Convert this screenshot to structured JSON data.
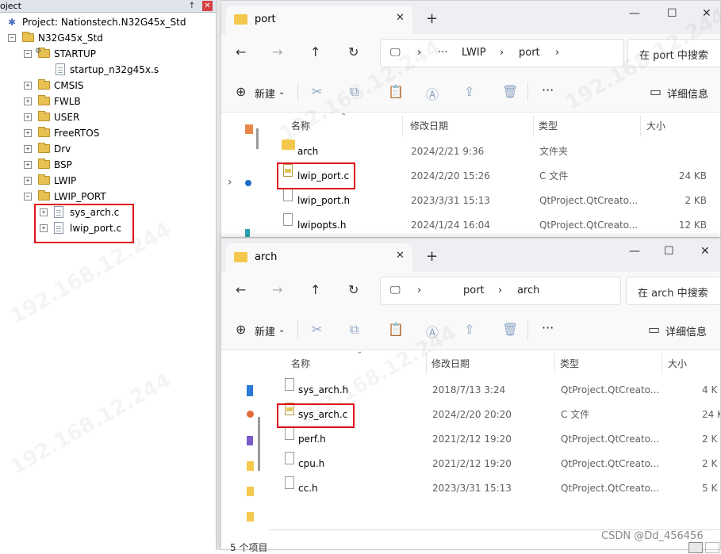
{
  "project": {
    "title": "oject",
    "pin_glyph": "↑",
    "close_glyph": "✕",
    "tree": [
      {
        "label": "Project: Nationstech.N32G45x_Std",
        "kind": "project"
      },
      {
        "label": "N32G45x_Std",
        "kind": "target"
      },
      {
        "label": "STARTUP",
        "kind": "group"
      },
      {
        "label": "startup_n32g45x.s",
        "kind": "file"
      },
      {
        "label": "CMSIS",
        "kind": "group"
      },
      {
        "label": "FWLB",
        "kind": "group"
      },
      {
        "label": "USER",
        "kind": "group"
      },
      {
        "label": "FreeRTOS",
        "kind": "group"
      },
      {
        "label": "Drv",
        "kind": "group"
      },
      {
        "label": "BSP",
        "kind": "group"
      },
      {
        "label": "LWIP",
        "kind": "group"
      },
      {
        "label": "LWIP_PORT",
        "kind": "group"
      },
      {
        "label": "sys_arch.c",
        "kind": "file"
      },
      {
        "label": "lwip_port.c",
        "kind": "file"
      }
    ]
  },
  "port_window": {
    "tab_label": "port",
    "breadcrumb": [
      "LWIP",
      "port"
    ],
    "breadcrumb_more": "···",
    "search_placeholder": "在 port 中搜索",
    "new_label": "新建",
    "details_label": "详细信息",
    "columns": [
      "名称",
      "修改日期",
      "类型",
      "大小"
    ],
    "rows": [
      {
        "name": "arch",
        "date": "2024/2/21 9:36",
        "type": "文件夹",
        "size": "",
        "icon": "folder"
      },
      {
        "name": "lwip_port.c",
        "date": "2024/2/20 15:26",
        "type": "C 文件",
        "size": "24 KB",
        "icon": "c-file"
      },
      {
        "name": "lwip_port.h",
        "date": "2023/3/31 15:13",
        "type": "QtProject.QtCreato...",
        "size": "2 KB",
        "icon": "h-file"
      },
      {
        "name": "lwipopts.h",
        "date": "2024/1/24 16:04",
        "type": "QtProject.QtCreato...",
        "size": "12 KB",
        "icon": "h-file"
      }
    ]
  },
  "arch_window": {
    "tab_label": "arch",
    "breadcrumb": [
      "port",
      "arch"
    ],
    "search_placeholder": "在 arch 中搜索",
    "new_label": "新建",
    "details_label": "详细信息",
    "columns": [
      "名称",
      "修改日期",
      "类型",
      "大小"
    ],
    "rows": [
      {
        "name": "sys_arch.h",
        "date": "2018/7/13 3:24",
        "type": "QtProject.QtCreato...",
        "size": "4 K",
        "icon": "h-file"
      },
      {
        "name": "sys_arch.c",
        "date": "2024/2/20 20:20",
        "type": "C 文件",
        "size": "24 K",
        "icon": "c-file"
      },
      {
        "name": "perf.h",
        "date": "2021/2/12 19:20",
        "type": "QtProject.QtCreato...",
        "size": "2 K",
        "icon": "h-file"
      },
      {
        "name": "cpu.h",
        "date": "2021/2/12 19:20",
        "type": "QtProject.QtCreato...",
        "size": "2 K",
        "icon": "h-file"
      },
      {
        "name": "cc.h",
        "date": "2023/3/31 15:13",
        "type": "QtProject.QtCreato...",
        "size": "5 K",
        "icon": "h-file"
      }
    ],
    "status": "5 个项目"
  },
  "watermark": "CSDN @Dd_456456",
  "bg_watermark": "192.168.12.244"
}
